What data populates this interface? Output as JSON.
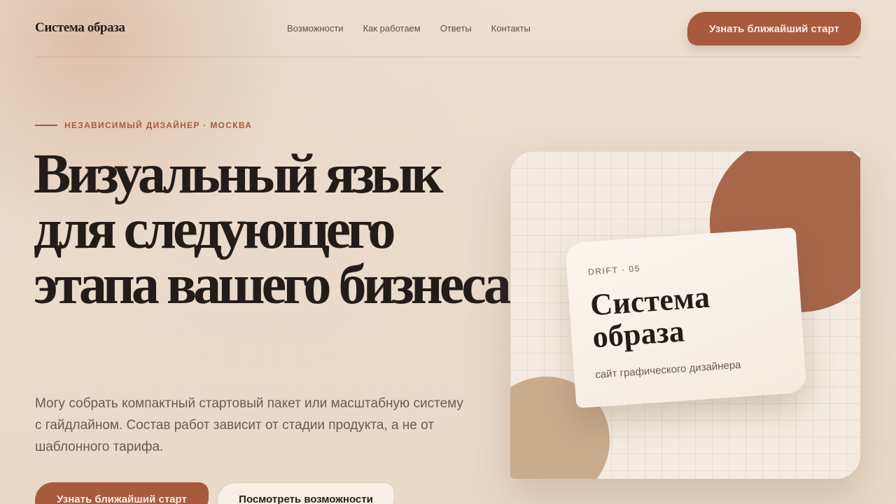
{
  "header": {
    "logo": "Система образа",
    "nav": [
      "Возможности",
      "Как работаем",
      "Ответы",
      "Контакты"
    ],
    "cta_label": "Узнать ближайший старт"
  },
  "hero": {
    "eyebrow": "НЕЗАВИСИМЫЙ ДИЗАЙНЕР · МОСКВА",
    "title": "Визуальный язык для следующего этапа вашего бизнеса",
    "text": "Могу собрать компактный стартовый пакет или масштабную систему с гайдлайном. Состав работ зависит от стадии продукта, а не от шаблонного тарифа.",
    "primary_label": "Узнать ближайший старт",
    "secondary_label": "Посмотреть возможности"
  },
  "visual": {
    "card_tag": "DRIFT · 05",
    "card_title": "Система образа",
    "card_subtitle": "сайт графического дизайнера"
  },
  "colors": {
    "accent": "#a85a3c",
    "background": "#e9dccb",
    "text": "#231d19",
    "muted": "#6b5a4f",
    "sand": "#c9ac8c"
  }
}
